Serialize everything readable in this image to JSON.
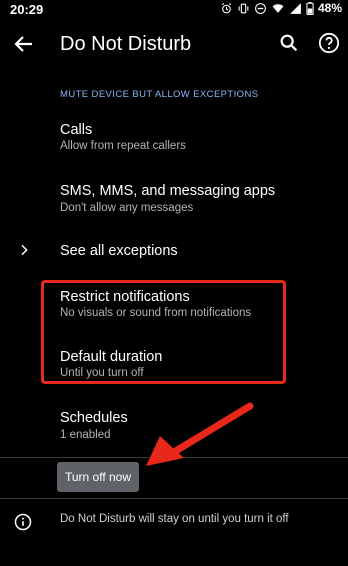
{
  "status_bar": {
    "time": "20:29",
    "battery": "48%",
    "icons": [
      "alarm-icon",
      "vibrate-icon",
      "dnd-icon",
      "wifi-icon",
      "signal-icon",
      "battery-icon"
    ]
  },
  "app_bar": {
    "title": "Do Not Disturb",
    "back_icon": "arrow-back-icon",
    "search_icon": "search-icon",
    "help_icon": "help-icon"
  },
  "section": {
    "header": "MUTE DEVICE BUT ALLOW EXCEPTIONS"
  },
  "items": {
    "calls": {
      "title": "Calls",
      "subtitle": "Allow from repeat callers"
    },
    "messages": {
      "title": "SMS, MMS, and messaging apps",
      "subtitle": "Don't allow any messages"
    },
    "see_all": {
      "title": "See all exceptions"
    },
    "restrict": {
      "title": "Restrict notifications",
      "subtitle": "No visuals or sound from notifications"
    },
    "duration": {
      "title": "Default duration",
      "subtitle": "Until you turn off"
    },
    "schedules": {
      "title": "Schedules",
      "subtitle": "1 enabled"
    }
  },
  "turn_off_button": "Turn off now",
  "footer": {
    "text": "Do Not Disturb will stay on until you turn it off"
  },
  "colors": {
    "accent": "#8ab4f8",
    "highlight": "#e8281a",
    "button": "#5f6368"
  }
}
